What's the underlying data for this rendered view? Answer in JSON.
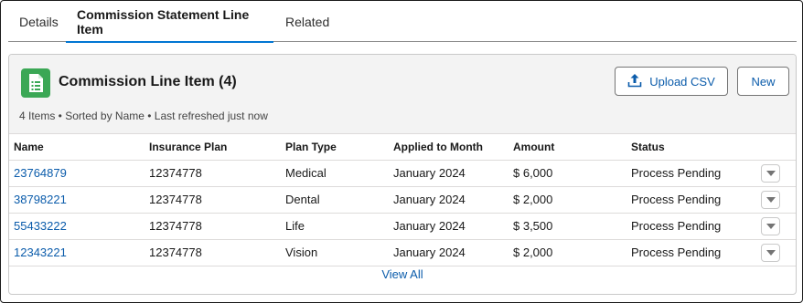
{
  "tabs": [
    {
      "label": "Details",
      "active": false
    },
    {
      "label": "Commission Statement Line Item",
      "active": true
    },
    {
      "label": "Related",
      "active": false
    }
  ],
  "card": {
    "icon": "document-list-icon",
    "icon_color": "#3ba755",
    "title": "Commission Line Item (4)",
    "meta": "4 Items • Sorted by Name • Last refreshed just now",
    "upload_label": "Upload CSV",
    "new_label": "New",
    "view_all": "View All"
  },
  "table": {
    "headers": [
      "Name",
      "Insurance Plan",
      "Plan Type",
      "Applied to Month",
      "Amount",
      "Status"
    ],
    "rows": [
      {
        "name": "23764879",
        "plan": "12374778",
        "type": "Medical",
        "month": "January 2024",
        "amount": "$ 6,000",
        "status": "Process Pending"
      },
      {
        "name": "38798221",
        "plan": "12374778",
        "type": "Dental",
        "month": "January 2024",
        "amount": "$ 2,000",
        "status": "Process Pending"
      },
      {
        "name": "55433222",
        "plan": "12374778",
        "type": "Life",
        "month": "January 2024",
        "amount": "$ 3,500",
        "status": "Process Pending"
      },
      {
        "name": "12343221",
        "plan": "12374778",
        "type": "Vision",
        "month": "January 2024",
        "amount": "$ 2,000",
        "status": "Process Pending"
      }
    ]
  },
  "colors": {
    "accent": "#0176d3",
    "link": "#0b5cab"
  }
}
